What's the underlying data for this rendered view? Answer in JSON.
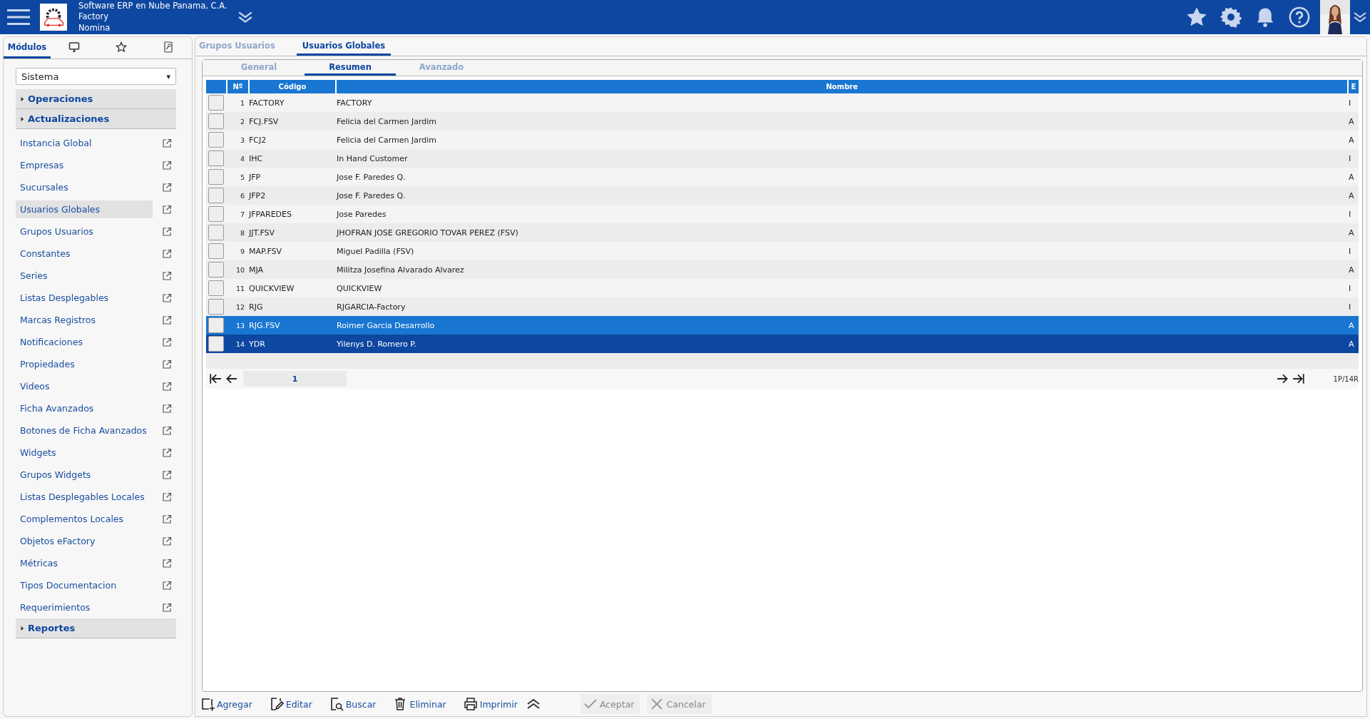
{
  "header": {
    "company": "Software ERP en Nube Panama, C.A.",
    "app": "Factory",
    "module": "Nomina"
  },
  "sidebar": {
    "tabs": [
      {
        "kind": "text",
        "label": "Módulos",
        "selected": true
      },
      {
        "kind": "monitor",
        "selected": false
      },
      {
        "kind": "star",
        "selected": false
      },
      {
        "kind": "key",
        "selected": false
      }
    ],
    "select": {
      "value": "Sistema",
      "arrow": "▾"
    },
    "items": [
      {
        "kind": "section",
        "label": "Operaciones",
        "expanded": false
      },
      {
        "kind": "section",
        "label": "Actualizaciones",
        "expanded": false
      },
      {
        "kind": "link",
        "label": "Instancia Global",
        "selected": false
      },
      {
        "kind": "link",
        "label": "Empresas",
        "selected": false
      },
      {
        "kind": "link",
        "label": "Sucursales",
        "selected": false
      },
      {
        "kind": "link",
        "label": "Usuarios Globales",
        "selected": true
      },
      {
        "kind": "link",
        "label": "Grupos Usuarios",
        "selected": false
      },
      {
        "kind": "link",
        "label": "Constantes",
        "selected": false
      },
      {
        "kind": "link",
        "label": "Series",
        "selected": false
      },
      {
        "kind": "link",
        "label": "Listas Desplegables",
        "selected": false
      },
      {
        "kind": "link",
        "label": "Marcas Registros",
        "selected": false
      },
      {
        "kind": "link",
        "label": "Notificaciones",
        "selected": false
      },
      {
        "kind": "link",
        "label": "Propiedades",
        "selected": false
      },
      {
        "kind": "link",
        "label": "Videos",
        "selected": false
      },
      {
        "kind": "link",
        "label": "Ficha Avanzados",
        "selected": false
      },
      {
        "kind": "link",
        "label": "Botones de Ficha Avanzados",
        "selected": false
      },
      {
        "kind": "link",
        "label": "Widgets",
        "selected": false
      },
      {
        "kind": "link",
        "label": "Grupos Widgets",
        "selected": false
      },
      {
        "kind": "link",
        "label": "Listas Desplegables Locales",
        "selected": false
      },
      {
        "kind": "link",
        "label": "Complementos Locales",
        "selected": false
      },
      {
        "kind": "link",
        "label": "Objetos eFactory",
        "selected": false
      },
      {
        "kind": "link",
        "label": "Métricas",
        "selected": false
      },
      {
        "kind": "link",
        "label": "Tipos Documentacion",
        "selected": false
      },
      {
        "kind": "link",
        "label": "Requerimientos",
        "selected": false
      },
      {
        "kind": "section",
        "label": "Reportes",
        "expanded": false
      }
    ]
  },
  "page_tabs": [
    {
      "label": "Grupos Usuarios",
      "selected": false
    },
    {
      "label": "Usuarios Globales",
      "selected": true
    }
  ],
  "sub_tabs": [
    {
      "label": "General",
      "selected": false
    },
    {
      "label": "Resumen",
      "selected": true
    },
    {
      "label": "Avanzado",
      "selected": false
    }
  ],
  "table": {
    "columns": [
      "Nº",
      "Código",
      "Nombre",
      "E"
    ],
    "rows": [
      {
        "n": "1",
        "code": "FACTORY",
        "name": "FACTORY",
        "e": "I",
        "selected": false,
        "hover": false
      },
      {
        "n": "2",
        "code": "FCJ.FSV",
        "name": "Felicia del Carmen Jardim",
        "e": "A",
        "selected": false,
        "hover": false
      },
      {
        "n": "3",
        "code": "FCJ2",
        "name": "Felicia del Carmen Jardim",
        "e": "A",
        "selected": false,
        "hover": false
      },
      {
        "n": "4",
        "code": "IHC",
        "name": "In Hand Customer",
        "e": "I",
        "selected": false,
        "hover": false
      },
      {
        "n": "5",
        "code": "JFP",
        "name": "Jose F. Paredes Q.",
        "e": "A",
        "selected": false,
        "hover": false
      },
      {
        "n": "6",
        "code": "JFP2",
        "name": "Jose F. Paredes Q.",
        "e": "A",
        "selected": false,
        "hover": false
      },
      {
        "n": "7",
        "code": "JFPAREDES",
        "name": "Jose Paredes",
        "e": "I",
        "selected": false,
        "hover": false
      },
      {
        "n": "8",
        "code": "JJT.FSV",
        "name": "JHOFRAN JOSE GREGORIO TOVAR PEREZ (FSV)",
        "e": "A",
        "selected": false,
        "hover": false
      },
      {
        "n": "9",
        "code": "MAP.FSV",
        "name": "Miguel Padilla (FSV)",
        "e": "I",
        "selected": false,
        "hover": false
      },
      {
        "n": "10",
        "code": "MJA",
        "name": "Militza Josefina Alvarado Alvarez",
        "e": "A",
        "selected": false,
        "hover": false
      },
      {
        "n": "11",
        "code": "QUICKVIEW",
        "name": "QUICKVIEW",
        "e": "I",
        "selected": false,
        "hover": false
      },
      {
        "n": "12",
        "code": "RJG",
        "name": "RJGARCIA-Factory",
        "e": "I",
        "selected": false,
        "hover": false
      },
      {
        "n": "13",
        "code": "RJG.FSV",
        "name": "Roimer Garcia Desarrollo",
        "e": "A",
        "selected": false,
        "hover": true
      },
      {
        "n": "14",
        "code": "YDR",
        "name": "Yilenys D. Romero P.",
        "e": "A",
        "selected": true,
        "hover": false
      }
    ]
  },
  "pagination": {
    "page": "1",
    "summary": "1P/14R"
  },
  "toolbar": [
    {
      "kind": "add",
      "label": "Agregar",
      "disabled": false
    },
    {
      "kind": "edit",
      "label": "Editar",
      "disabled": false
    },
    {
      "kind": "search",
      "label": "Buscar",
      "disabled": false
    },
    {
      "kind": "delete",
      "label": "Eliminar",
      "disabled": false
    },
    {
      "kind": "print",
      "label": "Imprimir",
      "disabled": false
    },
    {
      "kind": "more"
    },
    {
      "kind": "accept",
      "label": "Aceptar",
      "disabled": true
    },
    {
      "kind": "cancel",
      "label": "Cancelar",
      "disabled": true
    }
  ]
}
